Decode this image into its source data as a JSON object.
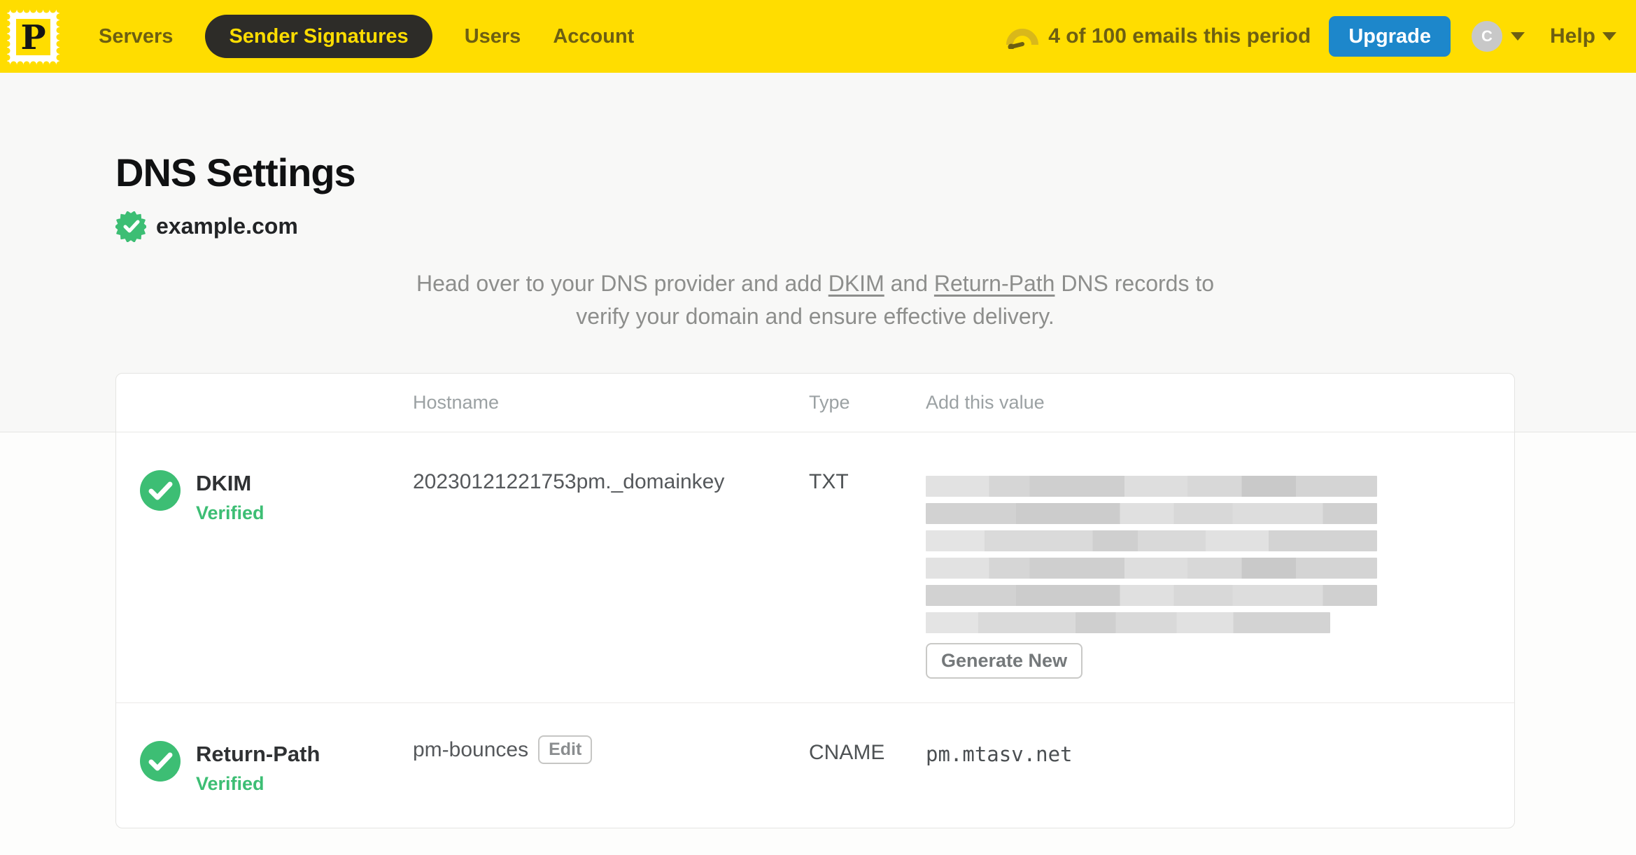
{
  "theme": {
    "yellow": "#FFDD00",
    "nav_text": "#6D5F12",
    "pill_bg": "#2D2C28",
    "upgrade_blue": "#1D87CB",
    "verified_green": "#3DBE74"
  },
  "nav": {
    "brand_letter": "P",
    "items": [
      {
        "label": "Servers",
        "active": false
      },
      {
        "label": "Sender Signatures",
        "active": true
      },
      {
        "label": "Users",
        "active": false
      },
      {
        "label": "Account",
        "active": false
      }
    ],
    "usage_text": "4 of 100 emails this period",
    "upgrade_label": "Upgrade",
    "avatar_initial": "C",
    "help_label": "Help"
  },
  "page": {
    "title": "DNS Settings",
    "domain": "example.com",
    "domain_status": "verified",
    "instructions": {
      "pre": "Head over to your DNS provider and add ",
      "link1": "DKIM",
      "mid": " and ",
      "link2": "Return-Path",
      "post1": " DNS records to",
      "post2": "verify your domain and ensure effective delivery."
    }
  },
  "table": {
    "headers": {
      "hostname": "Hostname",
      "type": "Type",
      "value": "Add this value"
    },
    "rows": [
      {
        "name": "DKIM",
        "status": "Verified",
        "hostname": "20230121221753pm._domainkey",
        "type": "TXT",
        "value_redacted": true,
        "redacted_bar_widths": [
          645,
          645,
          645,
          645,
          645,
          578
        ],
        "action": "Generate New"
      },
      {
        "name": "Return-Path",
        "status": "Verified",
        "hostname": "pm-bounces",
        "hostname_action": "Edit",
        "type": "CNAME",
        "value": "pm.mtasv.net"
      }
    ]
  }
}
